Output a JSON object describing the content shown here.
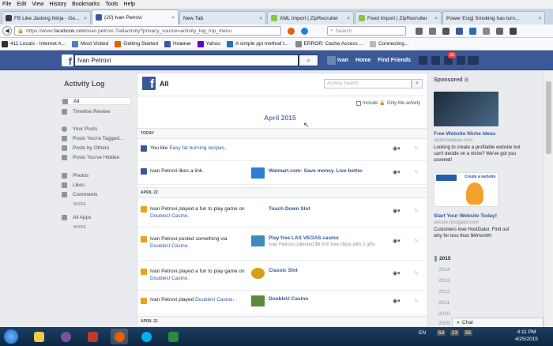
{
  "menubar": [
    "File",
    "Edit",
    "View",
    "History",
    "Bookmarks",
    "Tools",
    "Help"
  ],
  "tabs": [
    {
      "label": "FB Like Jacking Ninja - Ge...",
      "color": "#3a3a3a",
      "active": false
    },
    {
      "label": "(20) Ivan Petrovi",
      "color": "#3b5998",
      "active": true
    },
    {
      "label": "New Tab",
      "color": "#e8eef6",
      "active": false
    },
    {
      "label": "XML Import | ZipRecruiter",
      "color": "#8bc34a",
      "active": false
    },
    {
      "label": "Feed Import | ZipRecruiter",
      "color": "#8bc34a",
      "active": false
    },
    {
      "label": "Power Ecig| Smoking has turn...",
      "color": "#c0392b",
      "active": false
    }
  ],
  "navbar": {
    "url_prefix": "https://www.",
    "url_domain": "facebook.com",
    "url_path": "/ivan.petrovi.7/allactivity?privacy_source=activity_log_top_menu",
    "search_placeholder": "Search"
  },
  "bookmarks": [
    {
      "label": "411 Locals - Internet A...",
      "color": "#333"
    },
    {
      "label": "Most Visited",
      "color": "#4a7fc1"
    },
    {
      "label": "Getting Started",
      "color": "#e66000"
    },
    {
      "label": "Новини",
      "color": "#3b5998"
    },
    {
      "label": "Yahoo",
      "color": "#6001d2"
    },
    {
      "label": "A simple ppi method t...",
      "color": "#2a6ebb"
    },
    {
      "label": "ERROR: Cache Access ...",
      "color": "#888"
    },
    {
      "label": "Connecting...",
      "color": "#bbb"
    }
  ],
  "fb": {
    "logo": "f",
    "search_value": "Ivan Petrovi",
    "nav_name": "Ivan",
    "nav_home": "Home",
    "nav_find": "Find Friends",
    "notif_count": "20"
  },
  "sidebar": {
    "title": "Activity Log",
    "items": [
      {
        "label": "All",
        "selected": true
      },
      {
        "label": "Timeline Review",
        "selected": false
      },
      {
        "label": "Your Posts",
        "selected": false
      },
      {
        "label": "Posts You're Tagged...",
        "selected": false
      },
      {
        "label": "Posts by Others",
        "selected": false
      },
      {
        "label": "Posts You've Hidden",
        "selected": false
      },
      {
        "label": "Photos",
        "selected": false
      },
      {
        "label": "Likes",
        "selected": false
      },
      {
        "label": "Comments",
        "selected": false
      },
      {
        "label": "All Apps",
        "selected": false
      }
    ],
    "more_label": "MORE"
  },
  "panel": {
    "logo": "f",
    "title": "All",
    "search_placeholder": "Activity Search",
    "include_label": "Include",
    "only_me_label": "Only Me activity",
    "month": "April 2015",
    "sections": {
      "today": "TODAY",
      "apr22": "APRIL 22",
      "apr21": "APRIL 21"
    },
    "rows": [
      {
        "pre": "You like ",
        "link": "Easy fat burning recipes",
        "post": ".",
        "line2": "",
        "thumb_title": "",
        "thumb_sub": ""
      },
      {
        "pre": "Ivan Petrovi likes a link.",
        "link": "",
        "post": "",
        "line2": "",
        "thumb_title": "Walmart.com: Save money. Live better.",
        "thumb_sub": ""
      },
      {
        "pre": "Ivan Petrovi played a fun to play game on",
        "link": "",
        "post": "",
        "line2": "DoubleU Casino.",
        "thumb_title": "Touch Down Slot",
        "thumb_sub": ""
      },
      {
        "pre": "Ivan Petrovi posted something via",
        "link": "",
        "post": "",
        "line2": "DoubleU Casino.",
        "thumb_title": "Play free LAS VEGAS casino",
        "thumb_sub": "Ivan Petrovi collected $6,000 free chips with 2 gifts"
      },
      {
        "pre": "Ivan Petrovi played a fun to play game on",
        "link": "",
        "post": "",
        "line2": "DoubleU Casino.",
        "thumb_title": "Classic Slot",
        "thumb_sub": ""
      },
      {
        "pre": "Ivan Petrovi played ",
        "link": "DoubleU Casino",
        "post": ".",
        "line2": "",
        "thumb_title": "DoubleU Casino",
        "thumb_sub": ""
      }
    ]
  },
  "right": {
    "sponsored": "Sponsored",
    "ad1": {
      "title": "Free Website Niche Ideas",
      "domain": "vipnicheideas.com",
      "body": "Looking to create a profitable website but can't decide on a niche? We've got you covered!"
    },
    "ad2": {
      "title": "Start Your Website Today!",
      "domain": "secure.hostgator.com",
      "body": "Customers love HostGator. Find out why for less than $4/month!",
      "img_text": "Create a website"
    },
    "years": [
      "2015",
      "2014",
      "2013",
      "2012",
      "2011",
      "2010",
      "2009"
    ]
  },
  "chat_label": "Chat",
  "taskbar": {
    "lang": "EN",
    "time": "4:11 PM",
    "date": "4/25/2015",
    "tray_nums": [
      "53",
      "23",
      "55"
    ]
  }
}
